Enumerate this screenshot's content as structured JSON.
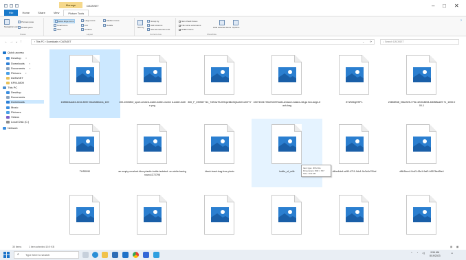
{
  "window": {
    "title": "DATASET",
    "manage_tab": "Manage",
    "controls": {
      "minimize": "–",
      "maximize": "□",
      "close": "✕"
    }
  },
  "ribbon_tabs": [
    "File",
    "Home",
    "Share",
    "View",
    "Picture Tools"
  ],
  "ribbon": {
    "panes": {
      "navigation_pane": "Navigation pane",
      "preview_pane": "Preview pane",
      "details_pane": "Details pane",
      "label": "Panes"
    },
    "layout": {
      "extra_large": "Extra large icons",
      "large": "Large icons",
      "medium": "Medium icons",
      "small": "Small icons",
      "list": "List",
      "details": "Details",
      "tiles": "Tiles",
      "content": "Content",
      "label": "Layout"
    },
    "current_view": {
      "sort_by": "Sort by",
      "group_by": "Group by",
      "add_columns": "Add columns",
      "size_all": "Size all columns to fit",
      "label": "Current view"
    },
    "show_hide": {
      "item_checkboxes": "Item check boxes",
      "file_name_extensions": "File name extensions",
      "hidden_items": "Hidden items",
      "hide_selected": "Hide selected items",
      "options": "Options",
      "label": "Show/hide"
    }
  },
  "address": {
    "path": "› This PC › Downloads › DATASET",
    "search_placeholder": "Search DATASET"
  },
  "nav_pane": [
    {
      "label": "Quick access",
      "color": "#1a73c9",
      "indent": 0,
      "pinned": false
    },
    {
      "label": "Desktop",
      "color": "#3b8ee0",
      "indent": 1,
      "pinned": true
    },
    {
      "label": "Downloads",
      "color": "#2d7fd6",
      "indent": 1,
      "pinned": true
    },
    {
      "label": "Documents",
      "color": "#8aa2bd",
      "indent": 1,
      "pinned": true
    },
    {
      "label": "Pictures",
      "color": "#4aa0e6",
      "indent": 1,
      "pinned": true
    },
    {
      "label": "DATASET",
      "color": "#e8c15a",
      "indent": 1,
      "pinned": false
    },
    {
      "label": "KPM-0809",
      "color": "#e8c15a",
      "indent": 1,
      "pinned": false
    },
    {
      "label": "This PC",
      "color": "#4b8fd1",
      "indent": 0,
      "pinned": false
    },
    {
      "label": "Desktop",
      "color": "#3b8ee0",
      "indent": 1,
      "pinned": false
    },
    {
      "label": "Documents",
      "color": "#8aa2bd",
      "indent": 1,
      "pinned": false
    },
    {
      "label": "Downloads",
      "color": "#2d7fd6",
      "indent": 1,
      "pinned": false
    },
    {
      "label": "Music",
      "color": "#3b8ee0",
      "indent": 1,
      "pinned": false
    },
    {
      "label": "Pictures",
      "color": "#4aa0e6",
      "indent": 1,
      "pinned": false
    },
    {
      "label": "Videos",
      "color": "#7a5fc9",
      "indent": 1,
      "pinned": false
    },
    {
      "label": "Local Disk (C:)",
      "color": "#8c8c8c",
      "indent": 1,
      "pinned": false
    },
    {
      "label": "Network",
      "color": "#3b8ee0",
      "indent": 0,
      "pinned": false
    }
  ],
  "files": [
    "1085bb4ac83-4242-8057-5fca3d6bcba_169",
    "100-1000802_sport-cricked-water-bottle-crushe d-water-bottle.png",
    "360_F_490567714_7xBnw7tUrh9xpz6ilwhQiuct40 u0i0YY",
    "43071531739a7be0f7bcd6-amazon-basics-18-ga llon-large-trash-bag",
    "8Y2K5bgHHFL",
    "23658948_0tfa1925-775e-4240-8653-4808f8ca09 71_1000.000-1",
    "THR0090",
    "an-empty-crushed-blue-plastic-bottle-isolated- on-white-background-D7J798",
    "black-trash-bag-free-photo",
    "bottle_of_milk",
    "d4be4de4-a0f0-4711-9dc1-0e3c0c7f1bd",
    "d8b3bcc4-0cd3-43a1-9af3-b5578ed5fe4",
    "",
    "",
    "",
    "",
    "",
    ""
  ],
  "tooltip": {
    "type": "Item type: JPG File",
    "dimensions": "Dimensions: 800 × 707",
    "size": "Size: 19.9 KB"
  },
  "status": {
    "count": "30 items",
    "selected": "1 item selected  19.9 KB"
  },
  "taskbar": {
    "search_placeholder": "Type here to search",
    "time": "9:54 AM",
    "date": "8/19/2023"
  },
  "colors": {
    "file_tab": "#1979ca",
    "manage_tab": "#f5d88b",
    "selection": "#cce8ff",
    "icon_blue": "#3a8fd8"
  }
}
